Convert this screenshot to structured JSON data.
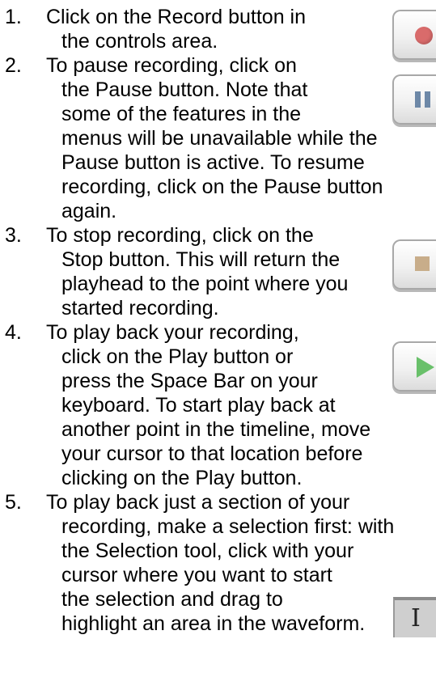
{
  "steps": [
    {
      "number": "1.",
      "lines": [
        "Click on the Record button in",
        "the controls area."
      ],
      "icon": "record-icon"
    },
    {
      "number": "2.",
      "lines": [
        "To pause recording, click on",
        "the Pause button. Note that",
        "some of the features in the",
        "menus will be unavailable while the",
        "Pause button is active. To resume",
        "recording, click on the Pause button",
        "again."
      ],
      "icon": "pause-icon"
    },
    {
      "number": "3.",
      "lines": [
        "To stop recording, click on the",
        "Stop button. This will return the",
        "playhead to the point where you",
        "started recording."
      ],
      "icon": "stop-icon"
    },
    {
      "number": "4.",
      "lines": [
        "To play back your recording,",
        "click on the Play button or",
        "press the Space Bar on your",
        "keyboard. To start play back at",
        "another point in the timeline, move",
        "your cursor to that location before",
        "clicking on the Play button."
      ],
      "icon": "play-icon"
    },
    {
      "number": "5.",
      "lines": [
        "To play back just a section of your",
        "recording, make a selection first: with",
        "the Selection tool, click with your",
        "cursor where you want to start",
        "the selection and drag to",
        "highlight an area in the waveform."
      ],
      "icon": "selection-tool-icon"
    }
  ],
  "colors": {
    "record": "#d96b6b",
    "pause": "#6d88a7",
    "stop": "#c8ad8a",
    "play": "#69c06a",
    "tool_bg": "#cfcfcf"
  }
}
